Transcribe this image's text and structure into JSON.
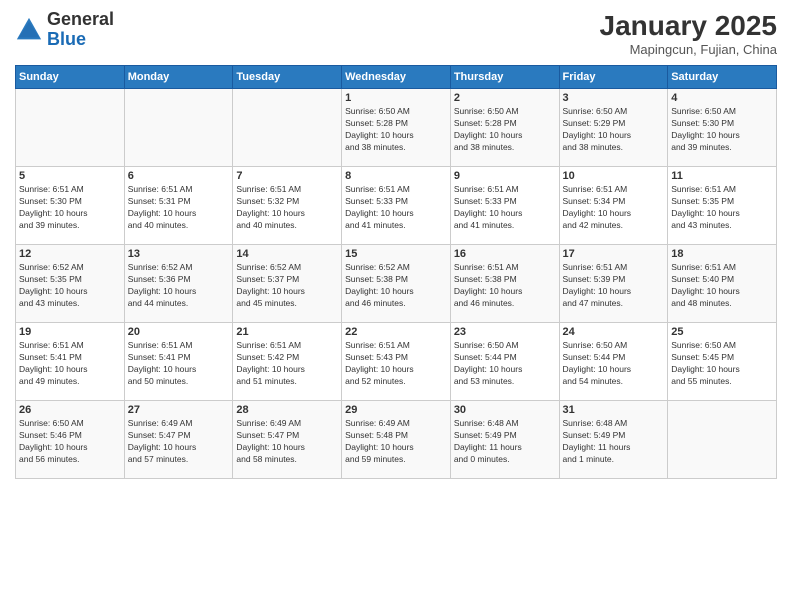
{
  "logo": {
    "general": "General",
    "blue": "Blue"
  },
  "header": {
    "month": "January 2025",
    "location": "Mapingcun, Fujian, China"
  },
  "weekdays": [
    "Sunday",
    "Monday",
    "Tuesday",
    "Wednesday",
    "Thursday",
    "Friday",
    "Saturday"
  ],
  "weeks": [
    [
      {
        "day": "",
        "info": ""
      },
      {
        "day": "",
        "info": ""
      },
      {
        "day": "",
        "info": ""
      },
      {
        "day": "1",
        "info": "Sunrise: 6:50 AM\nSunset: 5:28 PM\nDaylight: 10 hours\nand 38 minutes."
      },
      {
        "day": "2",
        "info": "Sunrise: 6:50 AM\nSunset: 5:28 PM\nDaylight: 10 hours\nand 38 minutes."
      },
      {
        "day": "3",
        "info": "Sunrise: 6:50 AM\nSunset: 5:29 PM\nDaylight: 10 hours\nand 38 minutes."
      },
      {
        "day": "4",
        "info": "Sunrise: 6:50 AM\nSunset: 5:30 PM\nDaylight: 10 hours\nand 39 minutes."
      }
    ],
    [
      {
        "day": "5",
        "info": "Sunrise: 6:51 AM\nSunset: 5:30 PM\nDaylight: 10 hours\nand 39 minutes."
      },
      {
        "day": "6",
        "info": "Sunrise: 6:51 AM\nSunset: 5:31 PM\nDaylight: 10 hours\nand 40 minutes."
      },
      {
        "day": "7",
        "info": "Sunrise: 6:51 AM\nSunset: 5:32 PM\nDaylight: 10 hours\nand 40 minutes."
      },
      {
        "day": "8",
        "info": "Sunrise: 6:51 AM\nSunset: 5:33 PM\nDaylight: 10 hours\nand 41 minutes."
      },
      {
        "day": "9",
        "info": "Sunrise: 6:51 AM\nSunset: 5:33 PM\nDaylight: 10 hours\nand 41 minutes."
      },
      {
        "day": "10",
        "info": "Sunrise: 6:51 AM\nSunset: 5:34 PM\nDaylight: 10 hours\nand 42 minutes."
      },
      {
        "day": "11",
        "info": "Sunrise: 6:51 AM\nSunset: 5:35 PM\nDaylight: 10 hours\nand 43 minutes."
      }
    ],
    [
      {
        "day": "12",
        "info": "Sunrise: 6:52 AM\nSunset: 5:35 PM\nDaylight: 10 hours\nand 43 minutes."
      },
      {
        "day": "13",
        "info": "Sunrise: 6:52 AM\nSunset: 5:36 PM\nDaylight: 10 hours\nand 44 minutes."
      },
      {
        "day": "14",
        "info": "Sunrise: 6:52 AM\nSunset: 5:37 PM\nDaylight: 10 hours\nand 45 minutes."
      },
      {
        "day": "15",
        "info": "Sunrise: 6:52 AM\nSunset: 5:38 PM\nDaylight: 10 hours\nand 46 minutes."
      },
      {
        "day": "16",
        "info": "Sunrise: 6:51 AM\nSunset: 5:38 PM\nDaylight: 10 hours\nand 46 minutes."
      },
      {
        "day": "17",
        "info": "Sunrise: 6:51 AM\nSunset: 5:39 PM\nDaylight: 10 hours\nand 47 minutes."
      },
      {
        "day": "18",
        "info": "Sunrise: 6:51 AM\nSunset: 5:40 PM\nDaylight: 10 hours\nand 48 minutes."
      }
    ],
    [
      {
        "day": "19",
        "info": "Sunrise: 6:51 AM\nSunset: 5:41 PM\nDaylight: 10 hours\nand 49 minutes."
      },
      {
        "day": "20",
        "info": "Sunrise: 6:51 AM\nSunset: 5:41 PM\nDaylight: 10 hours\nand 50 minutes."
      },
      {
        "day": "21",
        "info": "Sunrise: 6:51 AM\nSunset: 5:42 PM\nDaylight: 10 hours\nand 51 minutes."
      },
      {
        "day": "22",
        "info": "Sunrise: 6:51 AM\nSunset: 5:43 PM\nDaylight: 10 hours\nand 52 minutes."
      },
      {
        "day": "23",
        "info": "Sunrise: 6:50 AM\nSunset: 5:44 PM\nDaylight: 10 hours\nand 53 minutes."
      },
      {
        "day": "24",
        "info": "Sunrise: 6:50 AM\nSunset: 5:44 PM\nDaylight: 10 hours\nand 54 minutes."
      },
      {
        "day": "25",
        "info": "Sunrise: 6:50 AM\nSunset: 5:45 PM\nDaylight: 10 hours\nand 55 minutes."
      }
    ],
    [
      {
        "day": "26",
        "info": "Sunrise: 6:50 AM\nSunset: 5:46 PM\nDaylight: 10 hours\nand 56 minutes."
      },
      {
        "day": "27",
        "info": "Sunrise: 6:49 AM\nSunset: 5:47 PM\nDaylight: 10 hours\nand 57 minutes."
      },
      {
        "day": "28",
        "info": "Sunrise: 6:49 AM\nSunset: 5:47 PM\nDaylight: 10 hours\nand 58 minutes."
      },
      {
        "day": "29",
        "info": "Sunrise: 6:49 AM\nSunset: 5:48 PM\nDaylight: 10 hours\nand 59 minutes."
      },
      {
        "day": "30",
        "info": "Sunrise: 6:48 AM\nSunset: 5:49 PM\nDaylight: 11 hours\nand 0 minutes."
      },
      {
        "day": "31",
        "info": "Sunrise: 6:48 AM\nSunset: 5:49 PM\nDaylight: 11 hours\nand 1 minute."
      },
      {
        "day": "",
        "info": ""
      }
    ]
  ]
}
